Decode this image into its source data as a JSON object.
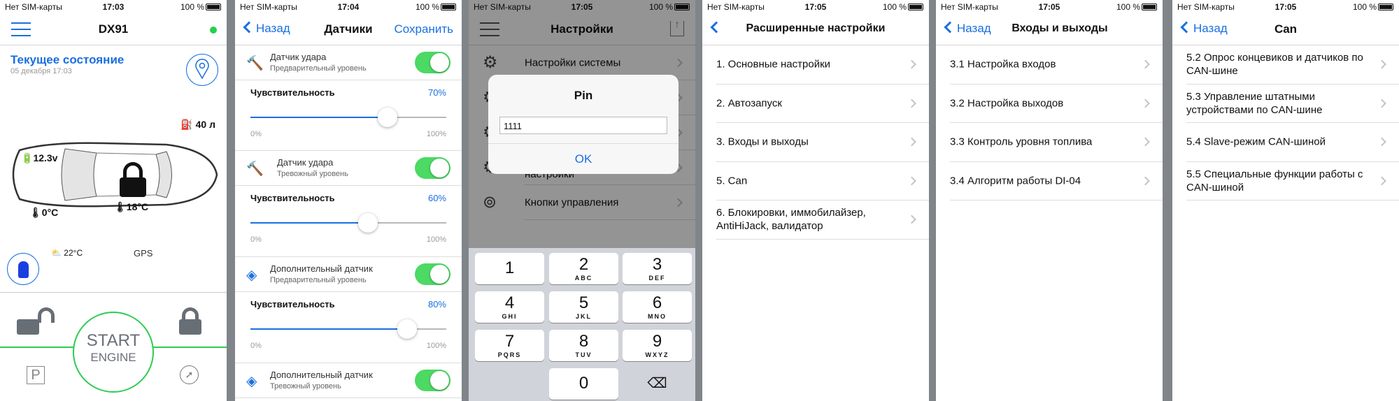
{
  "colors": {
    "accent": "#1a6fe0",
    "green": "#4cd964",
    "online": "#22d24a"
  },
  "status_bars": [
    {
      "carrier": "Нет SIM-карты",
      "time": "17:03",
      "battery": "100 %"
    },
    {
      "carrier": "Нет SIM-карты",
      "time": "17:04",
      "battery": "100 %"
    },
    {
      "carrier": "Нет SIM-карты",
      "time": "17:05",
      "battery": "100 %"
    },
    {
      "carrier": "Нет SIM-карты",
      "time": "17:05",
      "battery": "100 %"
    },
    {
      "carrier": "Нет SIM-карты",
      "time": "17:05",
      "battery": "100 %"
    },
    {
      "carrier": "Нет SIM-карты",
      "time": "17:05",
      "battery": "100 %"
    }
  ],
  "home": {
    "title": "DX91",
    "status_title": "Текущее состояние",
    "status_date": "05 декабря 17:03",
    "fuel": "40 л",
    "battery_voltage": "12.3v",
    "engine_temp": "0°C",
    "cabin_temp": "18°C",
    "weather_temp": "22°C",
    "gps": "GPS",
    "start_line1": "START",
    "start_line2": "ENGINE",
    "parking": "P",
    "online": true,
    "lock_state": "locked"
  },
  "sensors": {
    "back": "Назад",
    "title": "Датчики",
    "save": "Сохранить",
    "min_label": "0%",
    "max_label": "100%",
    "slider_label": "Чувствительность",
    "items": [
      {
        "title": "Датчик удара",
        "subtitle": "Предварительный уровень",
        "icon": "hammer-icon",
        "enabled": true,
        "value": 70,
        "value_label": "70%"
      },
      {
        "title": "Датчик удара",
        "subtitle": "Тревожный уровень",
        "icon": "hammer-impact-icon",
        "enabled": true,
        "value": 60,
        "value_label": "60%"
      },
      {
        "title": "Дополнительный датчик",
        "subtitle": "Предварительный уровень",
        "icon": "motion-sensor-icon",
        "enabled": true,
        "value": 80,
        "value_label": "80%"
      },
      {
        "title": "Дополнительный датчик",
        "subtitle": "Тревожный уровень",
        "icon": "motion-sensor-icon",
        "enabled": true
      }
    ]
  },
  "settings": {
    "title": "Настройки",
    "items": [
      "Настройки системы",
      "",
      "",
      "Мастер начальной настройки",
      "Кнопки управления"
    ],
    "dialog": {
      "title": "Pin",
      "value": "1111",
      "ok": "OK"
    },
    "keypad": [
      [
        "1",
        ""
      ],
      [
        "2",
        "ABC"
      ],
      [
        "3",
        "DEF"
      ],
      [
        "4",
        "GHI"
      ],
      [
        "5",
        "JKL"
      ],
      [
        "6",
        "MNO"
      ],
      [
        "7",
        "PQRS"
      ],
      [
        "8",
        "TUV"
      ],
      [
        "9",
        "WXYZ"
      ],
      [
        "",
        ""
      ],
      [
        "0",
        ""
      ],
      [
        "delete",
        ""
      ]
    ]
  },
  "advanced": {
    "title": "Расширенные настройки",
    "items": [
      "1. Основные настройки",
      "2. Автозапуск",
      "3. Входы и выходы",
      "5. Can",
      "6. Блокировки, иммобилайзер, AntiHiJack, валидатор"
    ]
  },
  "io": {
    "back": "Назад",
    "title": "Входы и выходы",
    "items": [
      "3.1 Настройка входов",
      "3.2 Настройка выходов",
      "3.3 Контроль уровня топлива",
      "3.4 Алгоритм работы DI-04"
    ]
  },
  "can": {
    "back": "Назад",
    "title": "Can",
    "items": [
      "5.2 Опрос концевиков и датчиков по CAN-шине",
      "5.3 Управление штатными устройствами по CAN-шине",
      "5.4 Slave-режим CAN-шиной",
      "5.5 Специальные функции работы с CAN-шиной"
    ]
  }
}
